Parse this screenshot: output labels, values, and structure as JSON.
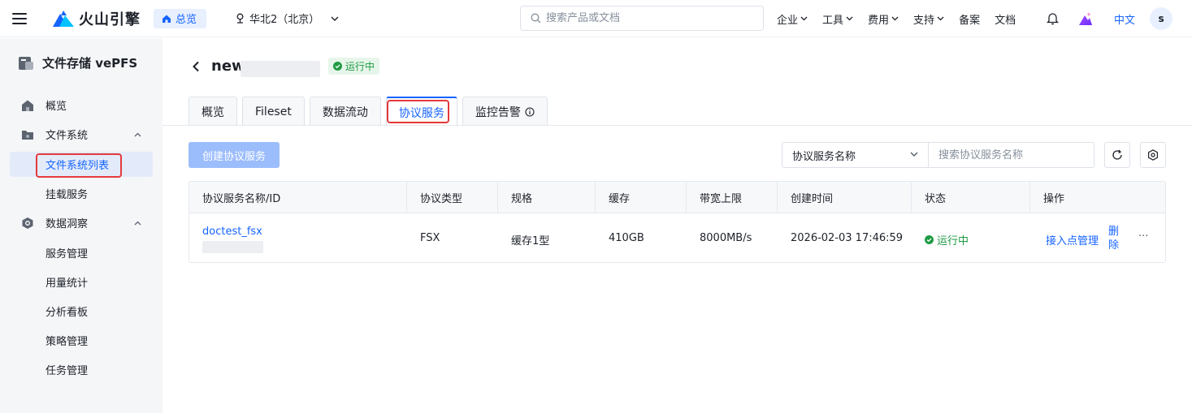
{
  "nav": {
    "logo_text": "火山引擎",
    "home_label": "总览",
    "region": "华北2（北京）",
    "search_placeholder": "搜索产品或文档",
    "links": [
      {
        "label": "企业",
        "has_caret": true
      },
      {
        "label": "工具",
        "has_caret": true
      },
      {
        "label": "费用",
        "has_caret": true
      },
      {
        "label": "支持",
        "has_caret": true
      },
      {
        "label": "备案",
        "has_caret": false
      },
      {
        "label": "文档",
        "has_caret": false
      }
    ],
    "lang": "中文",
    "avatar": "s"
  },
  "sidebar": {
    "title": "文件存储 vePFS",
    "items": [
      {
        "label": "概览"
      },
      {
        "label": "文件系统"
      },
      {
        "label": "文件系统列表"
      },
      {
        "label": "挂载服务"
      },
      {
        "label": "数据洞察"
      },
      {
        "label": "服务管理"
      },
      {
        "label": "用量统计"
      },
      {
        "label": "分析看板"
      },
      {
        "label": "策略管理"
      },
      {
        "label": "任务管理"
      }
    ]
  },
  "header": {
    "title": "new",
    "status": "运行中"
  },
  "tabs": [
    {
      "label": "概览"
    },
    {
      "label": "Fileset"
    },
    {
      "label": "数据流动"
    },
    {
      "label": "协议服务"
    },
    {
      "label": "监控告警"
    }
  ],
  "toolbar": {
    "create_label": "创建协议服务",
    "filter_select": "协议服务名称",
    "search_placeholder": "搜索协议服务名称"
  },
  "table": {
    "columns": [
      "协议服务名称/ID",
      "协议类型",
      "规格",
      "缓存",
      "带宽上限",
      "创建时间",
      "状态",
      "操作"
    ],
    "rows": [
      {
        "name": "doctest_fsx",
        "type": "FSX",
        "spec": "缓存1型",
        "cache": "410GB",
        "bandwidth": "8000MB/s",
        "created": "2026-02-03 17:46:59",
        "status": "运行中",
        "action_manage": "接入点管理",
        "action_delete_1": "删",
        "action_delete_2": "除",
        "action_more": "···"
      }
    ]
  },
  "colors": {
    "primary": "#1664ff",
    "success": "#1f9a44",
    "highlight": "#e5393c"
  }
}
